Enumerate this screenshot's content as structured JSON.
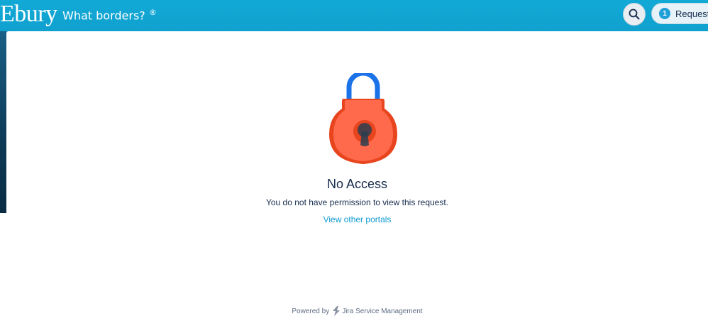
{
  "header": {
    "logo": "Ebury",
    "tagline": "What borders?",
    "tagline_mark": "®",
    "search_icon": "search-icon",
    "requests": {
      "count": "1",
      "label": "Requests"
    }
  },
  "main": {
    "icon": "lock-icon",
    "title": "No Access",
    "message": "You do not have permission to view this request.",
    "link_label": "View other portals"
  },
  "footer": {
    "powered_by": "Powered by",
    "product_icon": "jira-service-management-icon",
    "product": "Jira Service Management"
  },
  "colors": {
    "banner": "#0b8fbf",
    "lock_body": "#ff6a4d",
    "lock_shackle": "#1c72e8",
    "link": "#0f9bd0",
    "text": "#172b4d"
  }
}
